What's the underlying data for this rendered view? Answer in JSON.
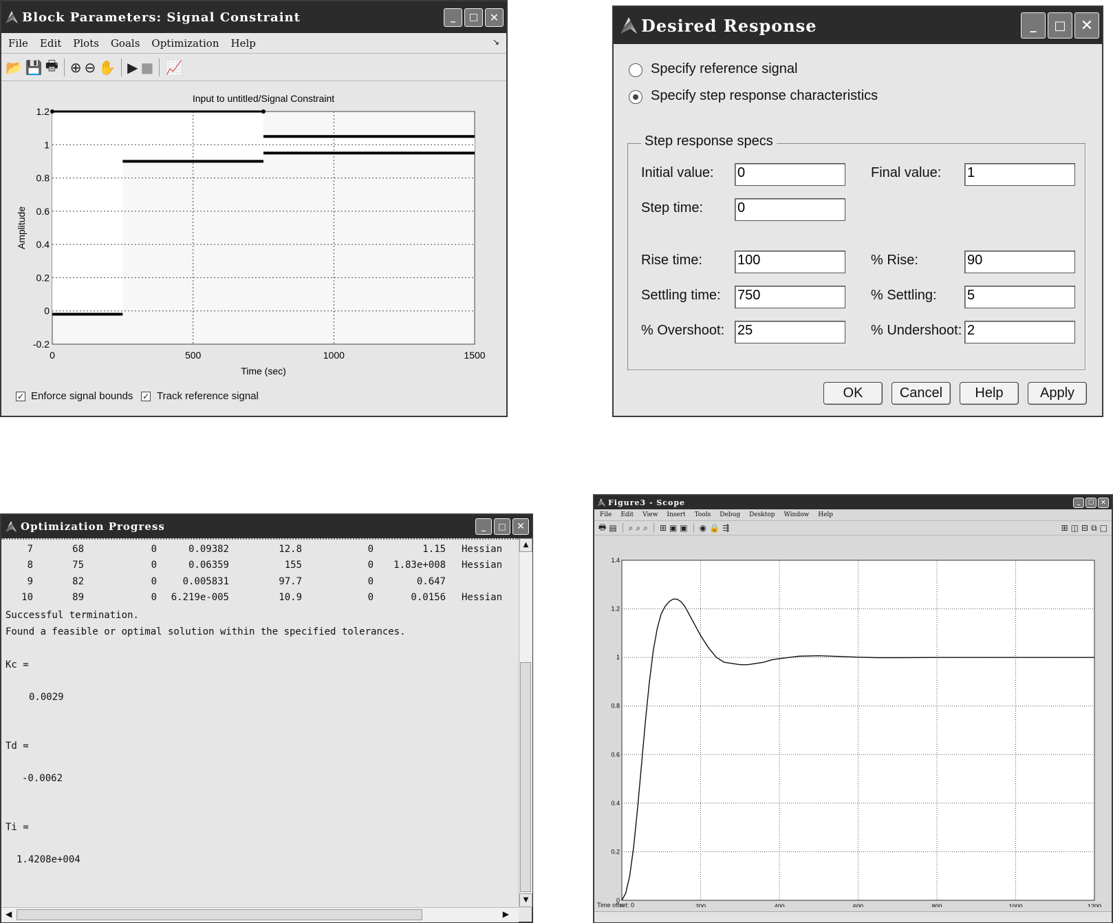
{
  "signal_constraint": {
    "title": "Block Parameters: Signal Constraint",
    "menu": [
      "File",
      "Edit",
      "Plots",
      "Goals",
      "Optimization",
      "Help"
    ],
    "plot_title": "Input to untitled/Signal Constraint",
    "ylabel": "Amplitude",
    "xlabel": "Time (sec)",
    "xticks": [
      "0",
      "500",
      "1000",
      "1500"
    ],
    "yticks": [
      "1.2",
      "1",
      "0.8",
      "0.6",
      "0.4",
      "0.2",
      "0",
      "-0.2"
    ],
    "checkbox_enforce": "Enforce signal bounds",
    "checkbox_track": "Track reference signal"
  },
  "desired_response": {
    "title": "Desired Response",
    "radio_reference": "Specify reference signal",
    "radio_step": "Specify step response characteristics",
    "group_title": "Step response specs",
    "initial_value_label": "Initial value:",
    "initial_value": "0",
    "final_value_label": "Final value:",
    "final_value": "1",
    "step_time_label": "Step time:",
    "step_time": "0",
    "rise_time_label": "Rise time:",
    "rise_time": "100",
    "pct_rise_label": "% Rise:",
    "pct_rise": "90",
    "settling_time_label": "Settling time:",
    "settling_time": "750",
    "pct_settling_label": "% Settling:",
    "pct_settling": "5",
    "overshoot_label": "% Overshoot:",
    "overshoot": "25",
    "undershoot_label": "% Undershoot:",
    "undershoot": "2",
    "ok": "OK",
    "cancel": "Cancel",
    "help": "Help",
    "apply": "Apply"
  },
  "optimization_progress": {
    "title": "Optimization Progress",
    "rows": [
      [
        "7",
        "68",
        "0",
        "0.09382",
        "12.8",
        "0",
        "1.15",
        "Hessian"
      ],
      [
        "8",
        "75",
        "0",
        "0.06359",
        "155",
        "0",
        "1.83e+008",
        "Hessian"
      ],
      [
        "9",
        "82",
        "0",
        "0.005831",
        "97.7",
        "0",
        "0.647",
        ""
      ],
      [
        "10",
        "89",
        "0",
        "6.219e-005",
        "10.9",
        "0",
        "0.0156",
        "Hessian"
      ]
    ],
    "msg1": "Successful termination.",
    "msg2": "Found a feasible or optimal solution within the specified tolerances.",
    "kc_label": "Kc =",
    "kc_value": "0.0029",
    "td_label": "Td =",
    "td_value": "-0.0062",
    "ti_label": "Ti =",
    "ti_value": "1.4208e+004"
  },
  "scope": {
    "title": "Figure3 - Scope",
    "menu": [
      "File",
      "Edit",
      "View",
      "Insert",
      "Tools",
      "Debug",
      "Desktop",
      "Window",
      "Help"
    ],
    "time_offset": "Time offset:  0",
    "xticks": [
      "0",
      "200",
      "400",
      "600",
      "800",
      "1000",
      "1200"
    ],
    "yticks": [
      "1.4",
      "1.2",
      "1",
      "0.8",
      "0.6",
      "0.4",
      "0.2",
      "0"
    ]
  },
  "chart_data": [
    {
      "type": "line",
      "title": "Input to untitled/Signal Constraint",
      "xlabel": "Time (sec)",
      "ylabel": "Amplitude",
      "xlim": [
        0,
        1500
      ],
      "ylim": [
        -0.2,
        1.2
      ],
      "grid": true,
      "series": [
        {
          "name": "upper bound",
          "x": [
            0,
            750,
            750,
            1500
          ],
          "y": [
            1.2,
            1.2,
            1.05,
            1.05
          ]
        },
        {
          "name": "lower bound",
          "x": [
            0,
            250,
            250,
            750,
            750,
            1500
          ],
          "y": [
            -0.02,
            -0.02,
            0.9,
            0.9,
            0.95,
            0.95
          ]
        }
      ]
    },
    {
      "type": "line",
      "xlim": [
        0,
        1200
      ],
      "ylim": [
        0,
        1.4
      ],
      "grid": true,
      "series": [
        {
          "x": [
            0,
            10,
            20,
            30,
            40,
            50,
            60,
            70,
            80,
            90,
            100,
            110,
            120,
            130,
            140,
            150,
            160,
            170,
            180,
            190,
            200,
            220,
            240,
            260,
            280,
            300,
            320,
            340,
            360,
            380,
            400,
            450,
            500,
            550,
            600,
            650,
            700,
            800,
            900,
            1000,
            1100,
            1200
          ],
          "y": [
            0,
            0.03,
            0.1,
            0.22,
            0.38,
            0.56,
            0.74,
            0.9,
            1.03,
            1.12,
            1.18,
            1.21,
            1.23,
            1.24,
            1.24,
            1.23,
            1.21,
            1.18,
            1.15,
            1.12,
            1.09,
            1.04,
            1.0,
            0.98,
            0.975,
            0.97,
            0.97,
            0.975,
            0.98,
            0.99,
            0.995,
            1.005,
            1.007,
            1.004,
            1.001,
            0.999,
            0.999,
            1.0,
            1.0,
            1.0,
            1.0,
            1.0
          ]
        }
      ]
    }
  ]
}
